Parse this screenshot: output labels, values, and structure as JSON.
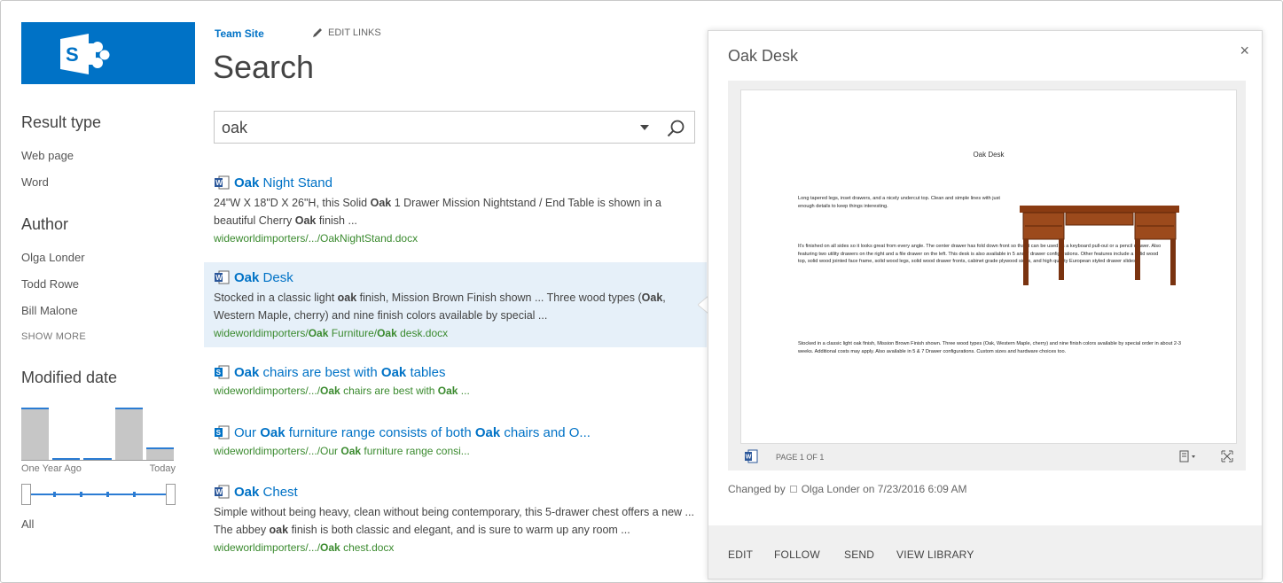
{
  "brand": {
    "color": "#0072c6",
    "logo_letter": "S"
  },
  "header": {
    "site_link": "Team Site",
    "edit_links": "EDIT LINKS",
    "page_title": "Search"
  },
  "search": {
    "query": "oak"
  },
  "refiners": {
    "result_type": {
      "heading": "Result type",
      "items": [
        "Web page",
        "Word"
      ]
    },
    "author": {
      "heading": "Author",
      "items": [
        "Olga Londer",
        "Todd Rowe",
        "Bill Malone"
      ],
      "show_more": "SHOW MORE"
    },
    "modified_date": {
      "heading": "Modified date",
      "label_start": "One Year Ago",
      "label_end": "Today",
      "selection": "All",
      "histogram_levels": [
        0.95,
        0.03,
        0.03,
        0.95,
        0.22
      ]
    }
  },
  "results": [
    {
      "title_parts": [
        {
          "t": "Oak",
          "b": true
        },
        {
          "t": " Night Stand",
          "b": false
        }
      ],
      "summary_parts": [
        {
          "t": "24\"W X 18\"D X 26\"H, this Solid ",
          "b": false
        },
        {
          "t": "Oak",
          "b": true
        },
        {
          "t": " 1 Drawer Mission Nightstand / End Table is shown in a beautiful Cherry ",
          "b": false
        },
        {
          "t": "Oak",
          "b": true
        },
        {
          "t": " finish ...",
          "b": false
        }
      ],
      "url_parts": [
        {
          "t": "wideworldimporters/.../OakNightStand.docx",
          "b": false
        }
      ]
    },
    {
      "title_parts": [
        {
          "t": "Oak",
          "b": true
        },
        {
          "t": " Desk",
          "b": false
        }
      ],
      "summary_parts": [
        {
          "t": "Stocked in a classic light ",
          "b": false
        },
        {
          "t": "oak",
          "b": true
        },
        {
          "t": " finish, Mission Brown Finish shown ... Three wood types (",
          "b": false
        },
        {
          "t": "Oak",
          "b": true
        },
        {
          "t": ", Western Maple, cherry) and nine finish colors available by special ...",
          "b": false
        }
      ],
      "url_parts": [
        {
          "t": "wideworldimporters/",
          "b": false
        },
        {
          "t": "Oak",
          "b": true
        },
        {
          "t": " Furniture/",
          "b": false
        },
        {
          "t": "Oak",
          "b": true
        },
        {
          "t": " desk.docx",
          "b": false
        }
      ]
    },
    {
      "title_parts": [
        {
          "t": "Oak",
          "b": true
        },
        {
          "t": " chairs are best with ",
          "b": false
        },
        {
          "t": "Oak",
          "b": true
        },
        {
          "t": " tables",
          "b": false
        }
      ],
      "summary_parts": [],
      "url_parts": [
        {
          "t": "wideworldimporters/.../",
          "b": false
        },
        {
          "t": "Oak",
          "b": true
        },
        {
          "t": " chairs are best with ",
          "b": false
        },
        {
          "t": "Oak",
          "b": true
        },
        {
          "t": " ...",
          "b": false
        }
      ]
    },
    {
      "title_parts": [
        {
          "t": "Our ",
          "b": false
        },
        {
          "t": "Oak",
          "b": true
        },
        {
          "t": " furniture range consists of both ",
          "b": false
        },
        {
          "t": "Oak",
          "b": true
        },
        {
          "t": " chairs and O...",
          "b": false
        }
      ],
      "summary_parts": [],
      "url_parts": [
        {
          "t": "wideworldimporters/.../Our ",
          "b": false
        },
        {
          "t": "Oak",
          "b": true
        },
        {
          "t": " furniture range consi...",
          "b": false
        }
      ]
    },
    {
      "title_parts": [
        {
          "t": "Oak",
          "b": true
        },
        {
          "t": " Chest",
          "b": false
        }
      ],
      "summary_parts": [
        {
          "t": "Simple without being heavy, clean without being contemporary, this 5-drawer chest offers a new ... The abbey ",
          "b": false
        },
        {
          "t": "oak",
          "b": true
        },
        {
          "t": " finish is both classic and elegant, and is sure to warm up any room ...",
          "b": false
        }
      ],
      "url_parts": [
        {
          "t": "wideworldimporters/.../",
          "b": false
        },
        {
          "t": "Oak",
          "b": true
        },
        {
          "t": " chest.docx",
          "b": false
        }
      ]
    }
  ],
  "preview": {
    "title": "Oak Desk",
    "close": "×",
    "doc_title": "Oak Desk",
    "doc_paragraphs": [
      "Long tapered legs, inset drawers, and a nicely undercut top. Clean and simple lines with just enough details to keep things interesting.",
      "It's finished on all sides so it looks great from every angle. The center drawer has fold down front so that it can be used as a keyboard pull-out or a pencil drawer. Also featuring two utility drawers on the right and a file drawer on the left. This desk is also available in 5 and 7 drawer configurations. Other features include a solid wood top, solid wood jointed face frame, solid wood legs, solid wood drawer fronts, cabinet grade plywood sides, and high quality European styled drawer slides.",
      "Stocked in a classic light oak finish, Mission Brown Finish shown. Three wood types (Oak, Western Maple, cherry) and nine finish colors available by special order in about 2-3 weeks. Additional costs may apply. Also available in 5 & 7 Drawer configurations. Custom sizes and hardware choices too."
    ],
    "page_indicator": "PAGE 1 OF 1",
    "changed_by": "Changed by",
    "changed_detail": "Olga Londer on 7/23/2016 6:09 AM",
    "actions": [
      "EDIT",
      "FOLLOW",
      "SEND",
      "VIEW LIBRARY"
    ]
  }
}
